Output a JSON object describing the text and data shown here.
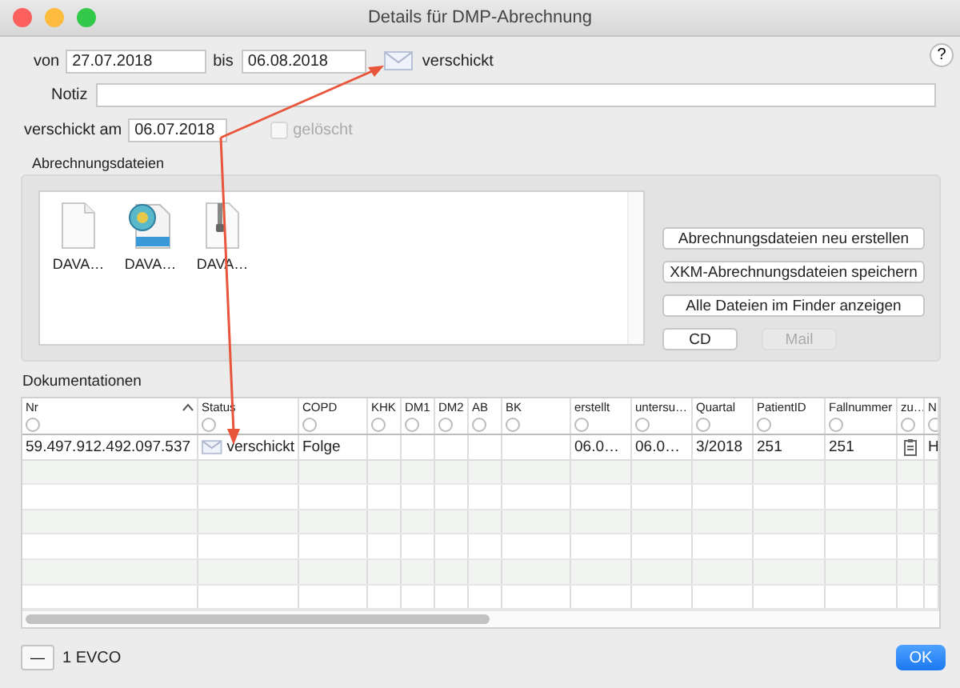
{
  "window": {
    "title": "Details für DMP-Abrechnung"
  },
  "help": "?",
  "period": {
    "from_label": "von",
    "from": "27.07.2018",
    "to_label": "bis",
    "to": "06.08.2018",
    "status": "verschickt"
  },
  "note": {
    "label": "Notiz"
  },
  "sent": {
    "label": "verschickt am",
    "value": "06.07.2018",
    "deleted_label": "gelöscht",
    "deleted_checked": false,
    "deleted_disabled": true
  },
  "files_group": {
    "title": "Abrechnungsdateien",
    "files": [
      {
        "name": "DAVA…",
        "kind": "document"
      },
      {
        "name": "DAVA…",
        "kind": "xkm"
      },
      {
        "name": "DAVA…",
        "kind": "zip"
      }
    ],
    "buttons": [
      {
        "label": "Abrechnungsdateien neu erstellen",
        "kind": "wide",
        "disabled": false
      },
      {
        "label": "XKM-Abrechnungsdateien speichern",
        "kind": "wide",
        "disabled": false
      },
      {
        "label": "Alle Dateien im Finder anzeigen",
        "kind": "wide",
        "disabled": false
      },
      {
        "label": "CD",
        "kind": "small",
        "disabled": false
      },
      {
        "label": "Mail",
        "kind": "small",
        "disabled": true
      }
    ]
  },
  "table": {
    "title": "Dokumentationen",
    "columns": [
      {
        "label": "Nr",
        "sorted": true
      },
      {
        "label": "Status",
        "sorted": false
      },
      {
        "label": "COPD",
        "sorted": false
      },
      {
        "label": "KHK",
        "sorted": false
      },
      {
        "label": "DM1",
        "sorted": false
      },
      {
        "label": "DM2",
        "sorted": false
      },
      {
        "label": "AB",
        "sorted": false
      },
      {
        "label": "BK",
        "sorted": false
      },
      {
        "label": "erstellt",
        "sorted": false
      },
      {
        "label": "untersu…",
        "sorted": false
      },
      {
        "label": "Quartal",
        "sorted": false
      },
      {
        "label": "PatientID",
        "sorted": false
      },
      {
        "label": "Fallnummer",
        "sorted": false
      },
      {
        "label": "zu…",
        "sorted": false
      },
      {
        "label": "N",
        "sorted": false
      }
    ],
    "rows": [
      {
        "cells": [
          {
            "kind": "text",
            "text": "59.497.912.492.097.537"
          },
          {
            "kind": "status",
            "text": "verschickt"
          },
          {
            "kind": "text",
            "text": "Folge"
          },
          {
            "kind": "empty"
          },
          {
            "kind": "empty"
          },
          {
            "kind": "empty"
          },
          {
            "kind": "empty"
          },
          {
            "kind": "empty"
          },
          {
            "kind": "text",
            "text": "06.0…"
          },
          {
            "kind": "text",
            "text": "06.0…"
          },
          {
            "kind": "text",
            "text": "3/2018"
          },
          {
            "kind": "text",
            "text": "251"
          },
          {
            "kind": "text",
            "text": "251"
          },
          {
            "kind": "clipboard"
          },
          {
            "kind": "text",
            "text": "H"
          }
        ]
      }
    ]
  },
  "footer": {
    "remove": "—",
    "count": "1 EVCO",
    "ok": "OK"
  }
}
